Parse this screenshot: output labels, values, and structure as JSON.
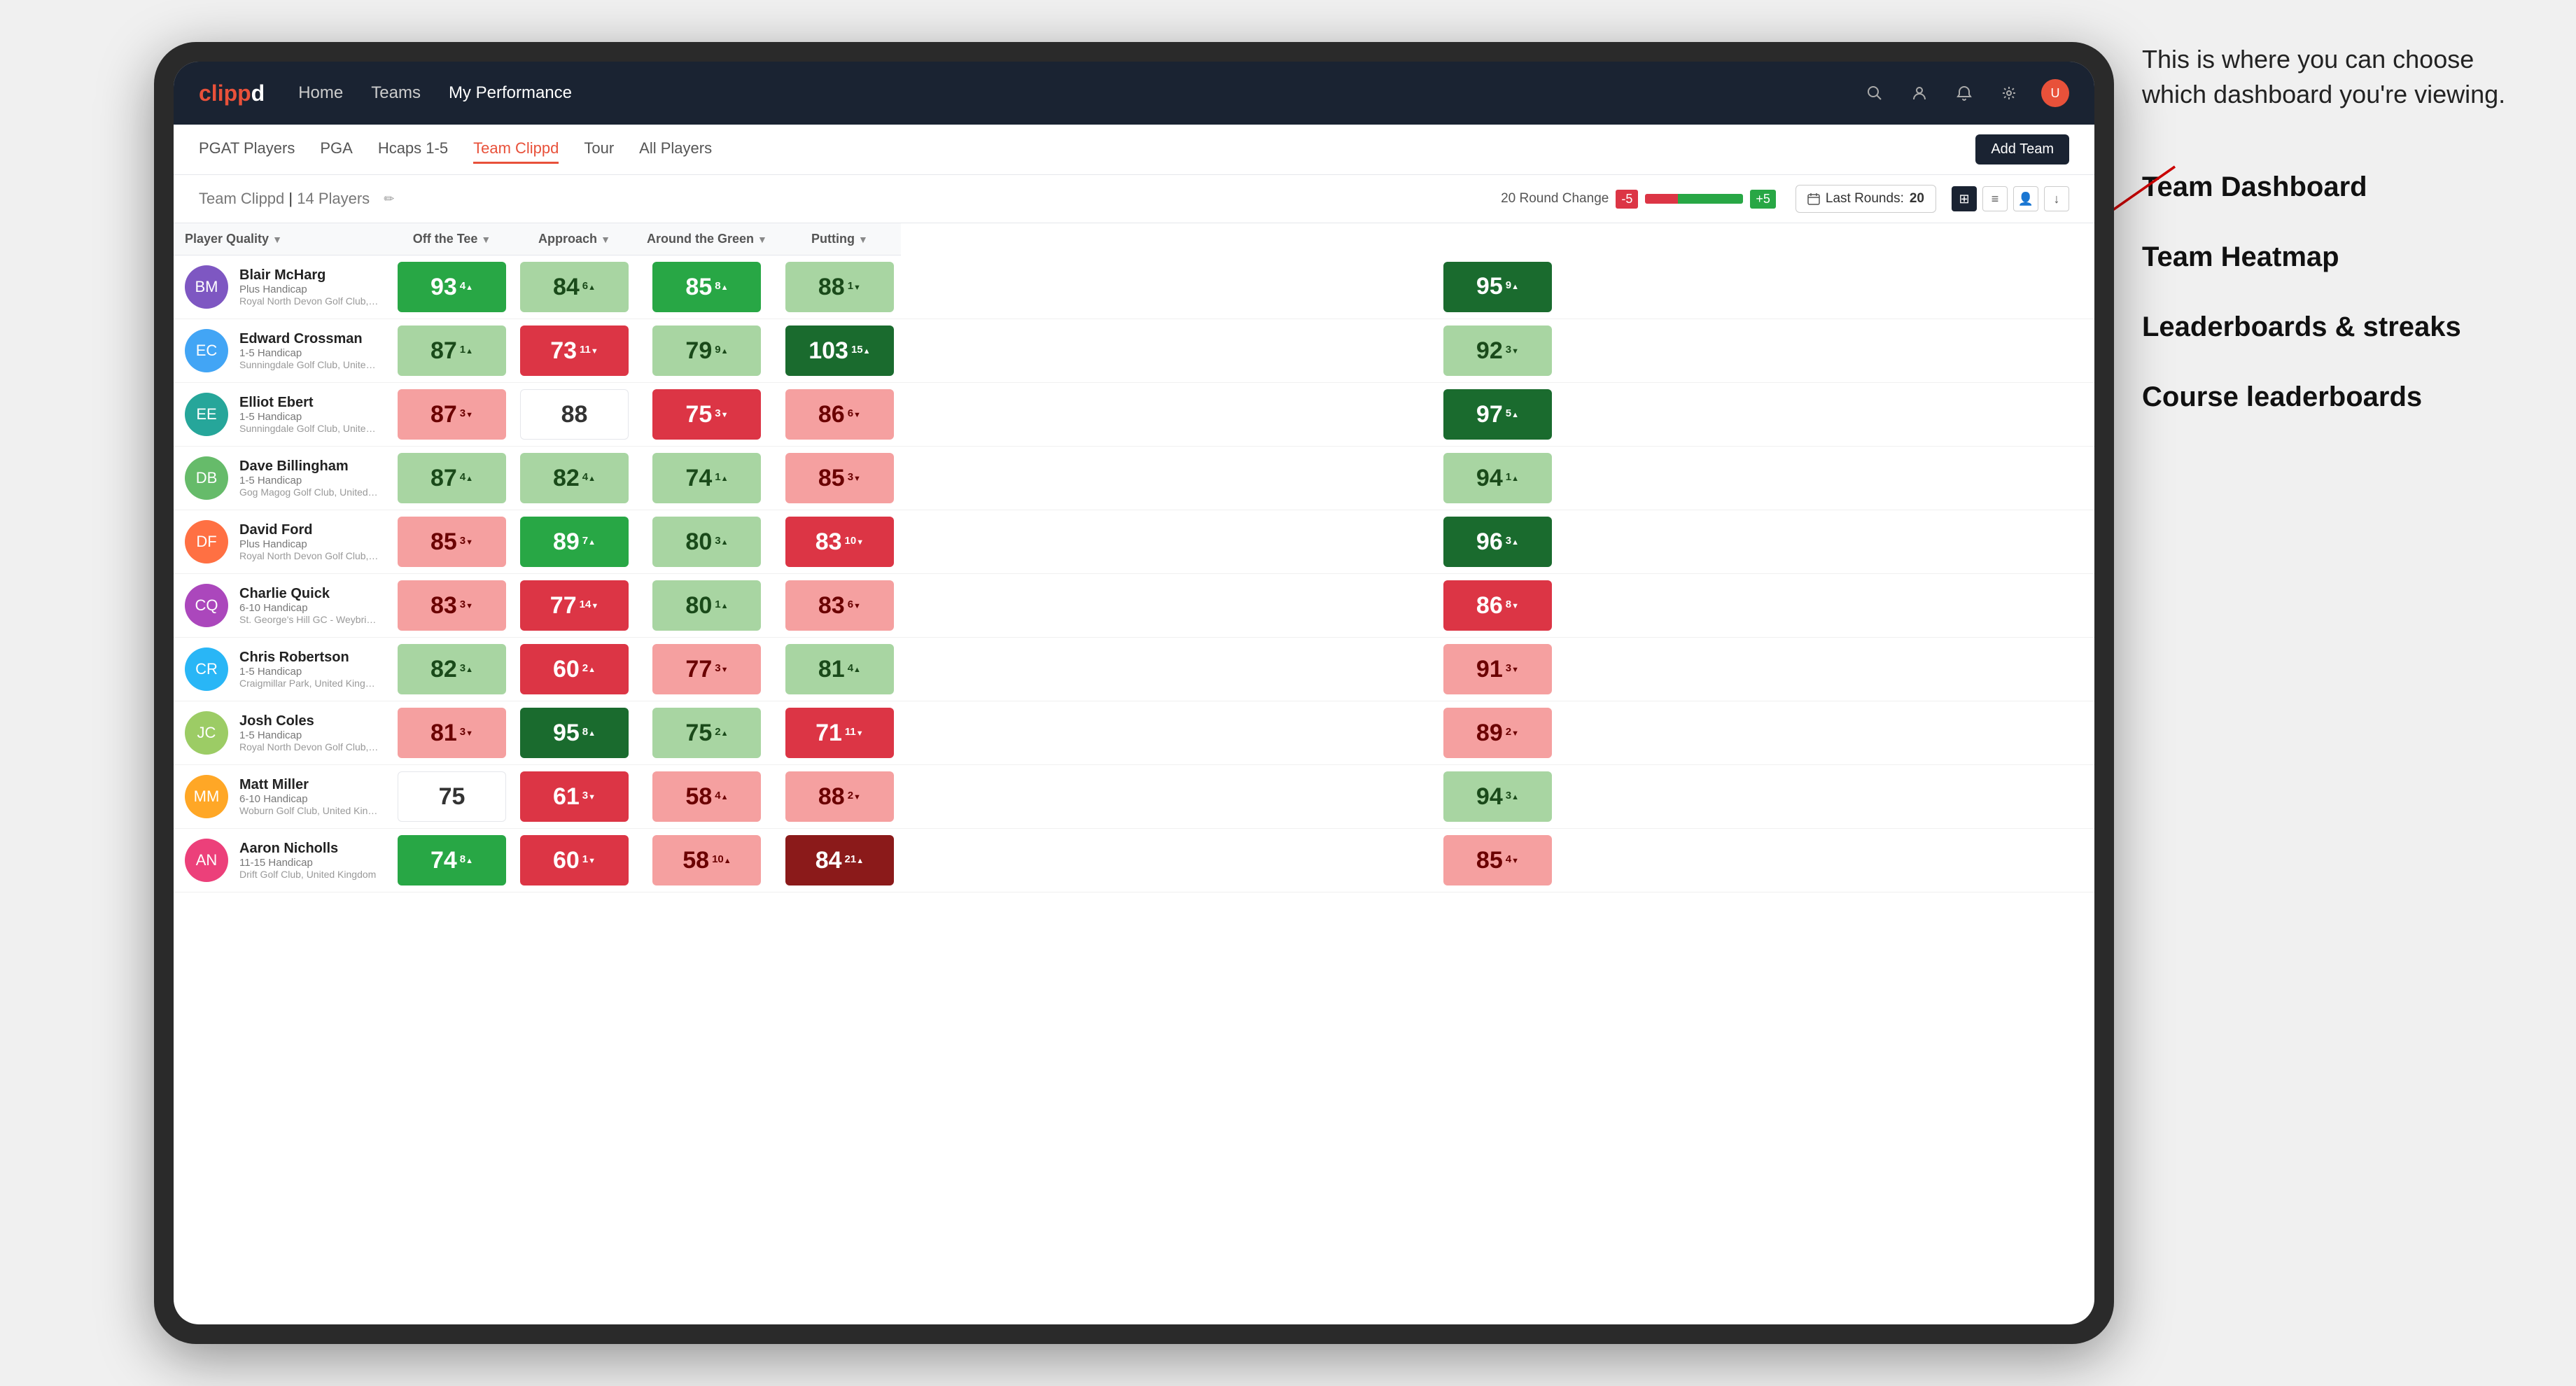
{
  "annotation": {
    "intro": "This is where you can choose which dashboard you're viewing.",
    "items": [
      {
        "label": "Team Dashboard"
      },
      {
        "label": "Team Heatmap"
      },
      {
        "label": "Leaderboards & streaks"
      },
      {
        "label": "Course leaderboards"
      }
    ]
  },
  "topNav": {
    "logo": "clippd",
    "links": [
      {
        "label": "Home",
        "active": false
      },
      {
        "label": "Teams",
        "active": false
      },
      {
        "label": "My Performance",
        "active": true
      }
    ],
    "icons": [
      "search",
      "person",
      "bell",
      "settings",
      "avatar"
    ]
  },
  "subNav": {
    "links": [
      {
        "label": "PGAT Players",
        "active": false
      },
      {
        "label": "PGA",
        "active": false
      },
      {
        "label": "Hcaps 1-5",
        "active": false
      },
      {
        "label": "Team Clippd",
        "active": true
      },
      {
        "label": "Tour",
        "active": false
      },
      {
        "label": "All Players",
        "active": false
      }
    ],
    "addTeamLabel": "Add Team"
  },
  "teamHeader": {
    "name": "Team Clippd",
    "count": "14 Players",
    "roundChangeLabel": "20 Round Change",
    "roundNeg": "-5",
    "roundPos": "+5",
    "lastRoundsLabel": "Last Rounds:",
    "lastRoundsValue": "20",
    "viewIcons": [
      "grid-2",
      "grid-1",
      "person-icon",
      "download-icon"
    ]
  },
  "tableHeaders": {
    "player": "Player Quality",
    "offTee": "Off the Tee",
    "approach": "Approach",
    "aroundGreen": "Around the Green",
    "putting": "Putting"
  },
  "players": [
    {
      "name": "Blair McHarg",
      "handicap": "Plus Handicap",
      "club": "Royal North Devon Golf Club, United Kingdom",
      "initials": "BM",
      "scores": {
        "playerQuality": {
          "value": "93",
          "change": "4",
          "dir": "up",
          "color": "green"
        },
        "offTee": {
          "value": "84",
          "change": "6",
          "dir": "up",
          "color": "light-green"
        },
        "approach": {
          "value": "85",
          "change": "8",
          "dir": "up",
          "color": "green"
        },
        "aroundGreen": {
          "value": "88",
          "change": "1",
          "dir": "down",
          "color": "light-green"
        },
        "putting": {
          "value": "95",
          "change": "9",
          "dir": "up",
          "color": "dark-green"
        }
      }
    },
    {
      "name": "Edward Crossman",
      "handicap": "1-5 Handicap",
      "club": "Sunningdale Golf Club, United Kingdom",
      "initials": "EC",
      "scores": {
        "playerQuality": {
          "value": "87",
          "change": "1",
          "dir": "up",
          "color": "light-green"
        },
        "offTee": {
          "value": "73",
          "change": "11",
          "dir": "down",
          "color": "red"
        },
        "approach": {
          "value": "79",
          "change": "9",
          "dir": "up",
          "color": "light-green"
        },
        "aroundGreen": {
          "value": "103",
          "change": "15",
          "dir": "up",
          "color": "dark-green"
        },
        "putting": {
          "value": "92",
          "change": "3",
          "dir": "down",
          "color": "light-green"
        }
      }
    },
    {
      "name": "Elliot Ebert",
      "handicap": "1-5 Handicap",
      "club": "Sunningdale Golf Club, United Kingdom",
      "initials": "EE",
      "scores": {
        "playerQuality": {
          "value": "87",
          "change": "3",
          "dir": "down",
          "color": "light-red"
        },
        "offTee": {
          "value": "88",
          "change": "",
          "dir": "",
          "color": "white"
        },
        "approach": {
          "value": "75",
          "change": "3",
          "dir": "down",
          "color": "red"
        },
        "aroundGreen": {
          "value": "86",
          "change": "6",
          "dir": "down",
          "color": "light-red"
        },
        "putting": {
          "value": "97",
          "change": "5",
          "dir": "up",
          "color": "dark-green"
        }
      }
    },
    {
      "name": "Dave Billingham",
      "handicap": "1-5 Handicap",
      "club": "Gog Magog Golf Club, United Kingdom",
      "initials": "DB",
      "scores": {
        "playerQuality": {
          "value": "87",
          "change": "4",
          "dir": "up",
          "color": "light-green"
        },
        "offTee": {
          "value": "82",
          "change": "4",
          "dir": "up",
          "color": "light-green"
        },
        "approach": {
          "value": "74",
          "change": "1",
          "dir": "up",
          "color": "light-green"
        },
        "aroundGreen": {
          "value": "85",
          "change": "3",
          "dir": "down",
          "color": "light-red"
        },
        "putting": {
          "value": "94",
          "change": "1",
          "dir": "up",
          "color": "light-green"
        }
      }
    },
    {
      "name": "David Ford",
      "handicap": "Plus Handicap",
      "club": "Royal North Devon Golf Club, United Kingdom",
      "initials": "DF",
      "scores": {
        "playerQuality": {
          "value": "85",
          "change": "3",
          "dir": "down",
          "color": "light-red"
        },
        "offTee": {
          "value": "89",
          "change": "7",
          "dir": "up",
          "color": "green"
        },
        "approach": {
          "value": "80",
          "change": "3",
          "dir": "up",
          "color": "light-green"
        },
        "aroundGreen": {
          "value": "83",
          "change": "10",
          "dir": "down",
          "color": "red"
        },
        "putting": {
          "value": "96",
          "change": "3",
          "dir": "up",
          "color": "dark-green"
        }
      }
    },
    {
      "name": "Charlie Quick",
      "handicap": "6-10 Handicap",
      "club": "St. George's Hill GC - Weybridge - Surrey, Uni...",
      "initials": "CQ",
      "scores": {
        "playerQuality": {
          "value": "83",
          "change": "3",
          "dir": "down",
          "color": "light-red"
        },
        "offTee": {
          "value": "77",
          "change": "14",
          "dir": "down",
          "color": "red"
        },
        "approach": {
          "value": "80",
          "change": "1",
          "dir": "up",
          "color": "light-green"
        },
        "aroundGreen": {
          "value": "83",
          "change": "6",
          "dir": "down",
          "color": "light-red"
        },
        "putting": {
          "value": "86",
          "change": "8",
          "dir": "down",
          "color": "red"
        }
      }
    },
    {
      "name": "Chris Robertson",
      "handicap": "1-5 Handicap",
      "club": "Craigmillar Park, United Kingdom",
      "initials": "CR",
      "scores": {
        "playerQuality": {
          "value": "82",
          "change": "3",
          "dir": "up",
          "color": "light-green"
        },
        "offTee": {
          "value": "60",
          "change": "2",
          "dir": "up",
          "color": "red"
        },
        "approach": {
          "value": "77",
          "change": "3",
          "dir": "down",
          "color": "light-red"
        },
        "aroundGreen": {
          "value": "81",
          "change": "4",
          "dir": "up",
          "color": "light-green"
        },
        "putting": {
          "value": "91",
          "change": "3",
          "dir": "down",
          "color": "light-red"
        }
      }
    },
    {
      "name": "Josh Coles",
      "handicap": "1-5 Handicap",
      "club": "Royal North Devon Golf Club, United Kingdom",
      "initials": "JC",
      "scores": {
        "playerQuality": {
          "value": "81",
          "change": "3",
          "dir": "down",
          "color": "light-red"
        },
        "offTee": {
          "value": "95",
          "change": "8",
          "dir": "up",
          "color": "dark-green"
        },
        "approach": {
          "value": "75",
          "change": "2",
          "dir": "up",
          "color": "light-green"
        },
        "aroundGreen": {
          "value": "71",
          "change": "11",
          "dir": "down",
          "color": "red"
        },
        "putting": {
          "value": "89",
          "change": "2",
          "dir": "down",
          "color": "light-red"
        }
      }
    },
    {
      "name": "Matt Miller",
      "handicap": "6-10 Handicap",
      "club": "Woburn Golf Club, United Kingdom",
      "initials": "MM",
      "scores": {
        "playerQuality": {
          "value": "75",
          "change": "",
          "dir": "",
          "color": "white"
        },
        "offTee": {
          "value": "61",
          "change": "3",
          "dir": "down",
          "color": "red"
        },
        "approach": {
          "value": "58",
          "change": "4",
          "dir": "up",
          "color": "light-red"
        },
        "aroundGreen": {
          "value": "88",
          "change": "2",
          "dir": "down",
          "color": "light-red"
        },
        "putting": {
          "value": "94",
          "change": "3",
          "dir": "up",
          "color": "light-green"
        }
      }
    },
    {
      "name": "Aaron Nicholls",
      "handicap": "11-15 Handicap",
      "club": "Drift Golf Club, United Kingdom",
      "initials": "AN",
      "scores": {
        "playerQuality": {
          "value": "74",
          "change": "8",
          "dir": "up",
          "color": "green"
        },
        "offTee": {
          "value": "60",
          "change": "1",
          "dir": "down",
          "color": "red"
        },
        "approach": {
          "value": "58",
          "change": "10",
          "dir": "up",
          "color": "light-red"
        },
        "aroundGreen": {
          "value": "84",
          "change": "21",
          "dir": "up",
          "color": "dark-red"
        },
        "putting": {
          "value": "85",
          "change": "4",
          "dir": "down",
          "color": "light-red"
        }
      }
    }
  ]
}
